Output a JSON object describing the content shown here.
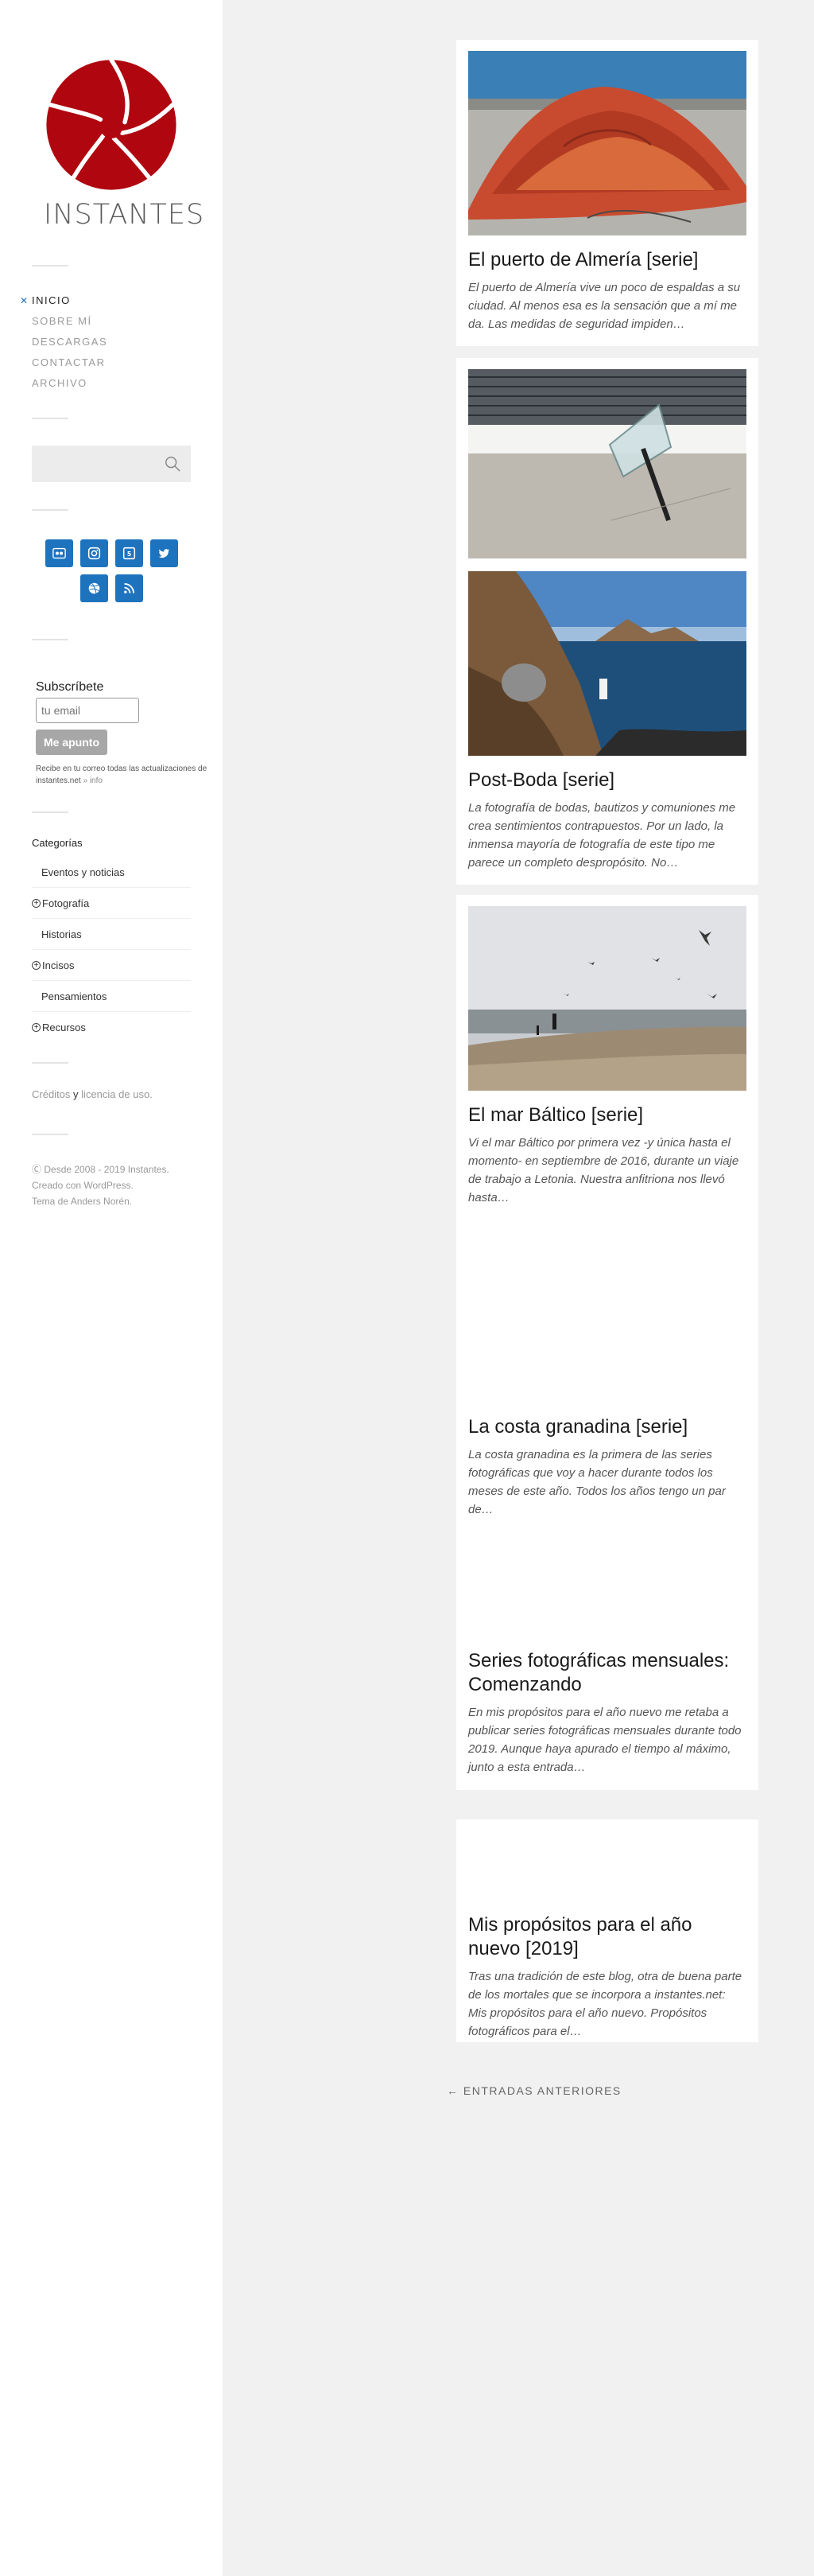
{
  "site": {
    "title": "INSTANTES",
    "logo_color": "#b0060f"
  },
  "nav": {
    "items": [
      {
        "label": "Inicio",
        "active": true
      },
      {
        "label": "Sobre mí",
        "active": false
      },
      {
        "label": "Descargas",
        "active": false
      },
      {
        "label": "Contactar",
        "active": false
      },
      {
        "label": "Archivo",
        "active": false
      }
    ]
  },
  "search": {
    "placeholder": "",
    "icon": "search-icon"
  },
  "social": {
    "accent": "#1e73be",
    "icons": [
      "flickr-icon",
      "instagram-icon",
      "500px-icon",
      "twitter-icon",
      "dribbble-icon",
      "rss-icon"
    ]
  },
  "subscribe": {
    "title": "Subscríbete",
    "placeholder": "tu email",
    "button": "Me apunto",
    "note": "Recibe en tu correo todas las actualizaciones de instantes.net",
    "info": "» info"
  },
  "categories": {
    "title": "Categorías",
    "items": [
      {
        "label": "Eventos y noticias",
        "expandable": false
      },
      {
        "label": "Fotografía",
        "expandable": true
      },
      {
        "label": "Historias",
        "expandable": false
      },
      {
        "label": "Incisos",
        "expandable": true
      },
      {
        "label": "Pensamientos",
        "expandable": false
      },
      {
        "label": "Recursos",
        "expandable": true
      }
    ]
  },
  "credits": {
    "creditos": "Créditos",
    "y": "y",
    "licencia": "licencia de uso."
  },
  "footer": {
    "line1": "Desde 2008 - 2019 Instantes.",
    "line2": "Creado con WordPress.",
    "line3": "Tema de Anders Norén."
  },
  "posts": [
    {
      "title": "El puerto de Almería [serie]",
      "excerpt": "El puerto de Almería vive un poco de espaldas a su ciudad. Al menos esa es la sensación que a mí me da. Las medidas de seguridad impiden…"
    },
    {
      "title": "Post-Boda [serie]",
      "excerpt": "La fotografía de bodas, bautizos y comuniones me crea sentimientos contrapuestos. Por un lado,  la inmensa mayoría de fotografía de este tipo me parece un completo despropósito. No…"
    },
    {
      "title": "El mar Báltico [serie]",
      "excerpt": "Vi el mar Báltico por primera vez -y única hasta el momento- en septiembre de 2016, durante un viaje de trabajo a Letonia. Nuestra anfitriona nos llevó hasta…"
    },
    {
      "title": "La costa granadina [serie]",
      "excerpt": "La costa granadina es la primera de las series fotográficas que voy a hacer durante todos los meses de este año. Todos los años tengo un par de…"
    },
    {
      "title": "Series fotográficas mensuales: Comenzando",
      "excerpt": "En mis propósitos para el año nuevo me retaba a publicar series fotográficas mensuales durante todo 2019. Aunque haya apurado el tiempo al máximo, junto a esta entrada…"
    },
    {
      "title": "Mis propósitos para el año nuevo [2019]",
      "excerpt": "Tras una tradición de este blog, otra de buena parte de los mortales que se incorpora a instantes.net: Mis propósitos para el año nuevo. Propósitos fotográficos para el…"
    }
  ],
  "pagination": {
    "older": "← Entradas anteriores"
  }
}
